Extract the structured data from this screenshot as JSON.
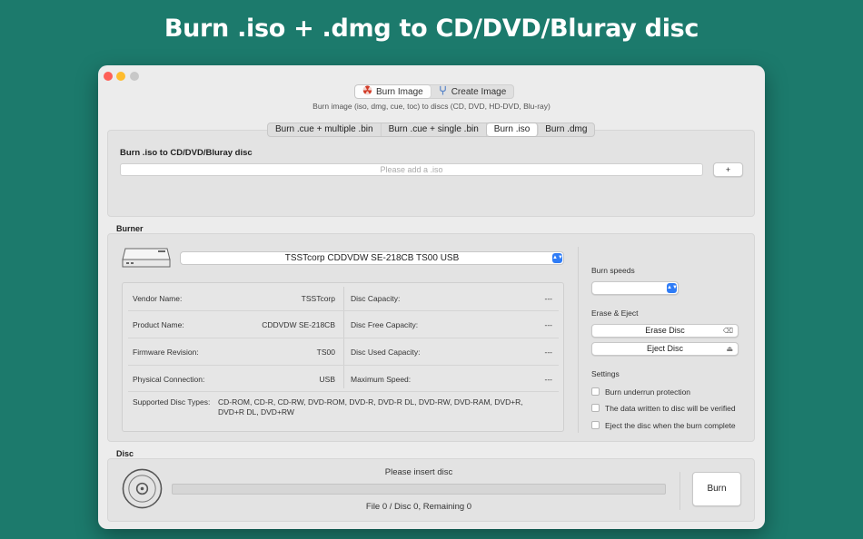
{
  "headline": "Burn .iso + .dmg to CD/DVD/Bluray disc",
  "modes": [
    {
      "label": "Burn Image",
      "icon": "radiation-icon",
      "active": true
    },
    {
      "label": "Create Image",
      "icon": "tuning-fork-icon",
      "active": false
    }
  ],
  "mode_subtitle": "Burn image (iso, dmg, cue, toc) to discs (CD, DVD, HD-DVD, Blu-ray)",
  "tabs": [
    {
      "label": "Burn .cue + multiple .bin",
      "active": false
    },
    {
      "label": "Burn .cue + single .bin",
      "active": false
    },
    {
      "label": "Burn .iso",
      "active": true
    },
    {
      "label": "Burn .dmg",
      "active": false
    }
  ],
  "iso_section": {
    "title": "Burn .iso to CD/DVD/Bluray disc",
    "placeholder": "Please add a .iso",
    "add_label": "+"
  },
  "burner": {
    "label": "Burner",
    "drive": "TSSTcorp CDDVDW SE-218CB TS00 USB",
    "left_info": [
      {
        "label": "Vendor Name:",
        "value": "TSSTcorp"
      },
      {
        "label": "Product Name:",
        "value": "CDDVDW SE-218CB"
      },
      {
        "label": "Firmware Revision:",
        "value": "TS00"
      },
      {
        "label": "Physical Connection:",
        "value": "USB"
      }
    ],
    "right_info": [
      {
        "label": "Disc Capacity:",
        "value": "---"
      },
      {
        "label": "Disc Free Capacity:",
        "value": "---"
      },
      {
        "label": "Disc Used Capacity:",
        "value": "---"
      },
      {
        "label": "Maximum Speed:",
        "value": "---"
      }
    ],
    "supported_label": "Supported Disc Types:",
    "supported_value": "CD-ROM, CD-R, CD-RW, DVD-ROM, DVD-R, DVD-R DL, DVD-RW, DVD-RAM, DVD+R, DVD+R DL, DVD+RW",
    "burn_speeds_label": "Burn speeds",
    "burn_speed_value": "",
    "erase_eject_label": "Erase & Eject",
    "erase_label": "Erase Disc",
    "eject_label": "Eject Disc",
    "settings_label": "Settings",
    "settings": [
      {
        "label": "Burn underrun protection",
        "checked": false
      },
      {
        "label": "The data written to disc will be verified",
        "checked": false
      },
      {
        "label": "Eject the disc when the burn complete",
        "checked": false
      }
    ]
  },
  "disc": {
    "label": "Disc",
    "status": "Please insert disc",
    "progress": 0,
    "counter": "File 0 / Disc 0, Remaining 0",
    "burn_label": "Burn"
  },
  "colors": {
    "background": "#1c7a6c",
    "accent": "#2f7cf6"
  }
}
